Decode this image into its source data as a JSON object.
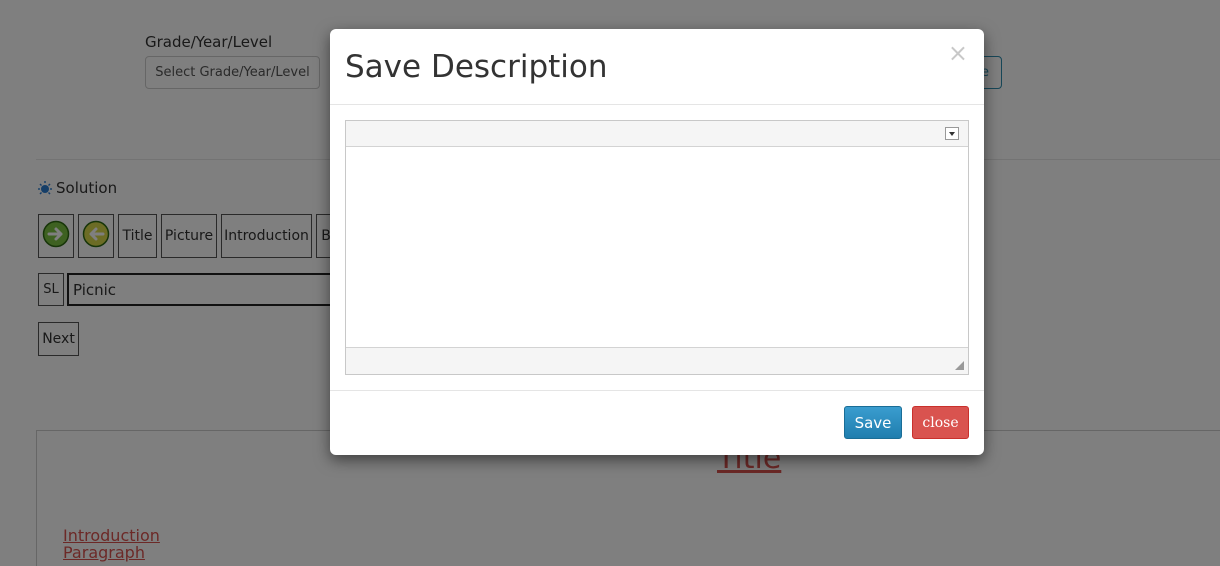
{
  "form": {
    "grade_label": "Grade/Year/Level",
    "grade_select_value": "Select Grade/Year/Level",
    "right_button_label": "e"
  },
  "solution": {
    "label": "Solution",
    "icon": "bulb-icon"
  },
  "toolbar": {
    "forward_icon": "arrow-right-icon",
    "back_icon": "arrow-left-icon",
    "buttons": [
      "Title",
      "Picture",
      "Introduction",
      "B"
    ]
  },
  "sl_row": {
    "sl_label": "SL",
    "input_value": "Picnic"
  },
  "next_label": "Next",
  "preview": {
    "title": "Title",
    "links": [
      "Introduction",
      "Paragraph"
    ]
  },
  "modal": {
    "title": "Save Description",
    "close_icon": "×",
    "save_label": "Save",
    "close_label": "close"
  },
  "colors": {
    "accent": "#2a8fc1",
    "danger": "#d9534f",
    "link": "#d9534f"
  }
}
